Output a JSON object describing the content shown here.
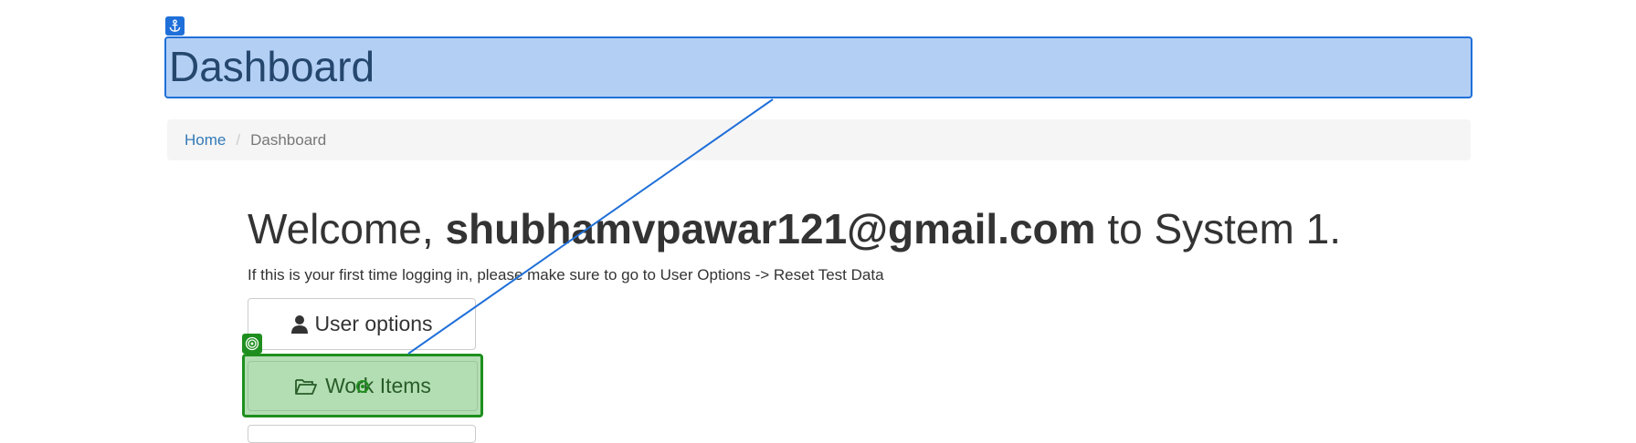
{
  "page": {
    "title": "Dashboard"
  },
  "breadcrumb": {
    "home": "Home",
    "separator": "/",
    "current": "Dashboard"
  },
  "welcome": {
    "prefix": "Welcome, ",
    "email": "shubhamvpawar121@gmail.com",
    "suffix": " to System 1."
  },
  "notice": "If this is your first time logging in, please make sure to go to User Options -> Reset Test Data",
  "buttons": {
    "user_options": "User options",
    "work_items": "Work Items"
  },
  "overlay": {
    "anchor_icon": "anchor-icon",
    "target_icon": "target-icon",
    "anchor_color": "#1f6fd8",
    "target_color": "#1e8f1e"
  }
}
